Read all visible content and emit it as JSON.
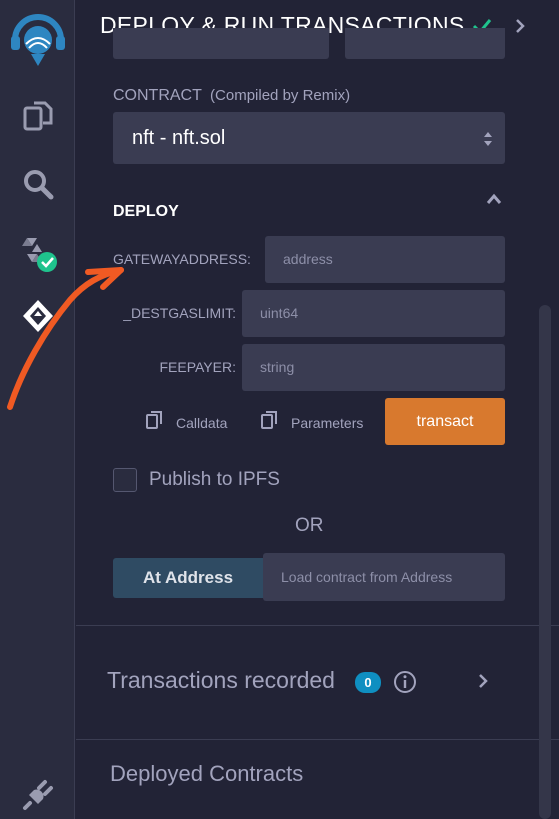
{
  "sidebar": {
    "icons": [
      "remix-logo-icon",
      "file-explorer-icon",
      "search-icon",
      "solidity-compiler-icon",
      "deploy-run-icon",
      "plugin-manager-icon"
    ]
  },
  "header": {
    "title": "DEPLOY & RUN TRANSACTIONS"
  },
  "contract": {
    "label": "CONTRACT",
    "sublabel": "(Compiled by Remix)",
    "selected": "nft - nft.sol"
  },
  "deploy": {
    "section_label": "DEPLOY",
    "params": [
      {
        "label": "GATEWAYADDRESS:",
        "placeholder": "address"
      },
      {
        "label": "_DESTGASLIMIT:",
        "placeholder": "uint64"
      },
      {
        "label": "FEEPAYER:",
        "placeholder": "string"
      }
    ],
    "calldata_label": "Calldata",
    "parameters_label": "Parameters",
    "transact_label": "transact"
  },
  "publish": {
    "label": "Publish to IPFS",
    "checked": false
  },
  "or_label": "OR",
  "at_address": {
    "button_label": "At Address",
    "placeholder": "Load contract from Address"
  },
  "transactions": {
    "label": "Transactions recorded",
    "count": "0"
  },
  "deployed": {
    "label": "Deployed Contracts"
  },
  "colors": {
    "accent_orange": "#d8792e",
    "check_green": "#1fc38d",
    "badge_blue": "#0f8fc1",
    "annotation_arrow": "#f05a23"
  }
}
